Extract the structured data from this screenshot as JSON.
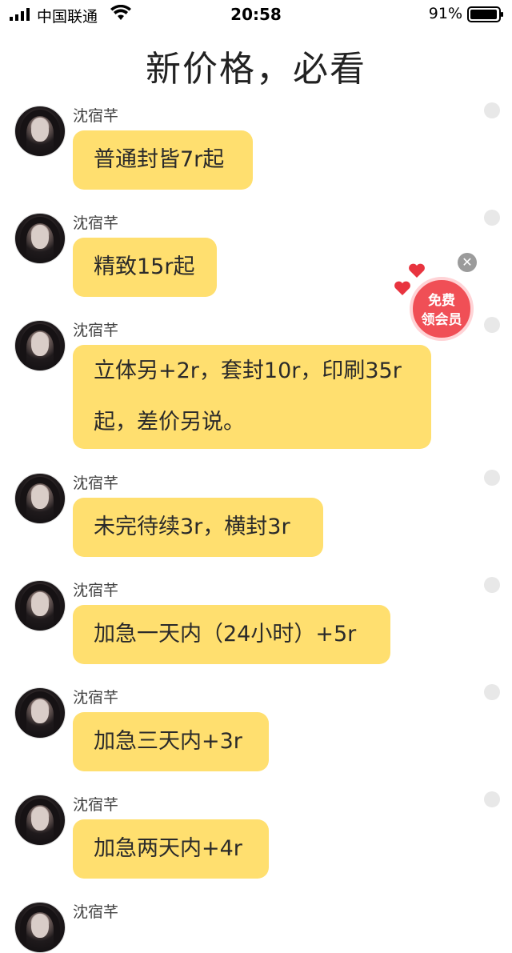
{
  "status_bar": {
    "carrier": "中国联通",
    "time": "20:58",
    "battery": "91%"
  },
  "header": {
    "title": "新价格，必看"
  },
  "messages": [
    {
      "sender": "沈宿芊",
      "text": "普通封皆7r起"
    },
    {
      "sender": "沈宿芊",
      "text": "精致15r起"
    },
    {
      "sender": "沈宿芊",
      "text_line1": "立体另+2r，套封10r，印刷35r",
      "text_line2": "起，差价另说。"
    },
    {
      "sender": "沈宿芊",
      "text": "未完待续3r，横封3r"
    },
    {
      "sender": "沈宿芊",
      "text": "加急一天内（24小时）+5r"
    },
    {
      "sender": "沈宿芊",
      "text": "加急三天内+3r"
    },
    {
      "sender": "沈宿芊",
      "text": "加急两天内+4r"
    },
    {
      "sender": "沈宿芊"
    }
  ],
  "promo": {
    "line1": "免费",
    "line2": "领会员",
    "close_glyph": "✕"
  },
  "colors": {
    "bubble": "#ffdf6f",
    "promo": "#f04f56"
  }
}
